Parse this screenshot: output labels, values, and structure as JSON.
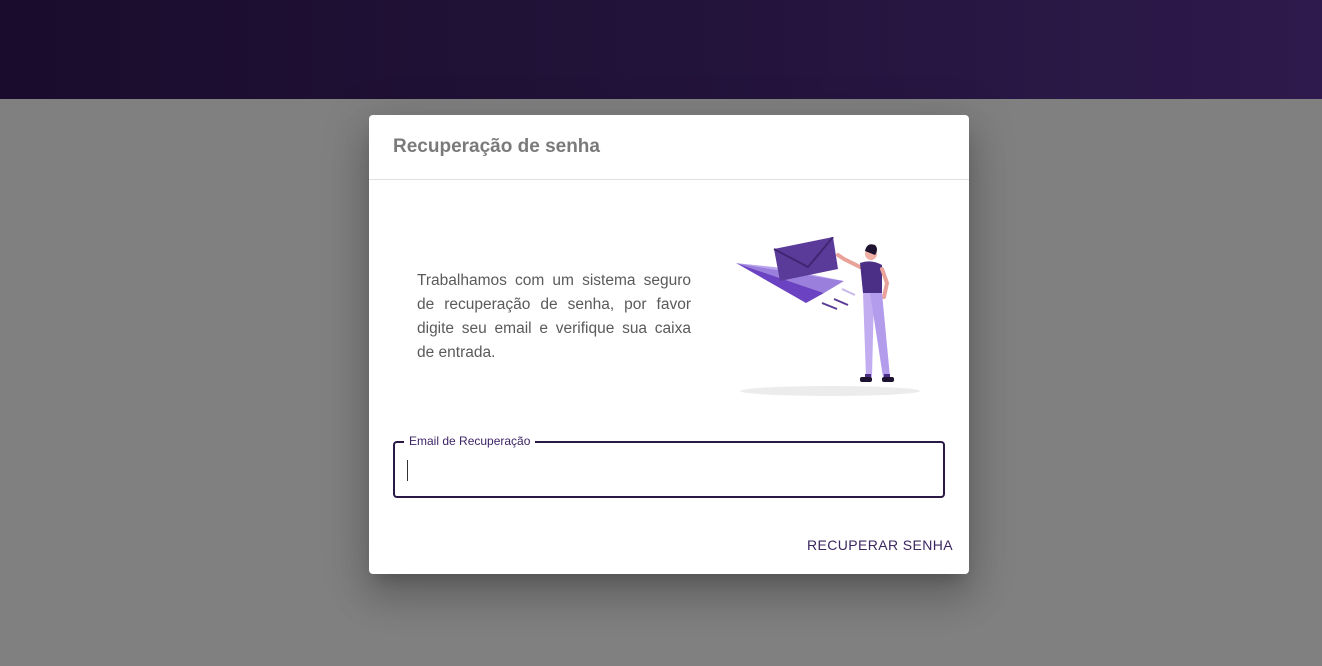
{
  "dialog": {
    "title": "Recuperação de senha",
    "intro": "Trabalhamos com um sistema seguro de recuperação de senha, por favor digite seu email e verifique sua caixa de entrada.",
    "email_label": "Email de Recuperação",
    "email_value": "",
    "submit_label": "RECUPERAR SENHA"
  },
  "colors": {
    "header_gradient_start": "#1a0c2c",
    "header_gradient_end": "#2e1a4c",
    "accent": "#3b2760",
    "illustration_primary": "#6b43c2"
  },
  "icons": {
    "illustration": "person-sending-envelope-illustration"
  }
}
